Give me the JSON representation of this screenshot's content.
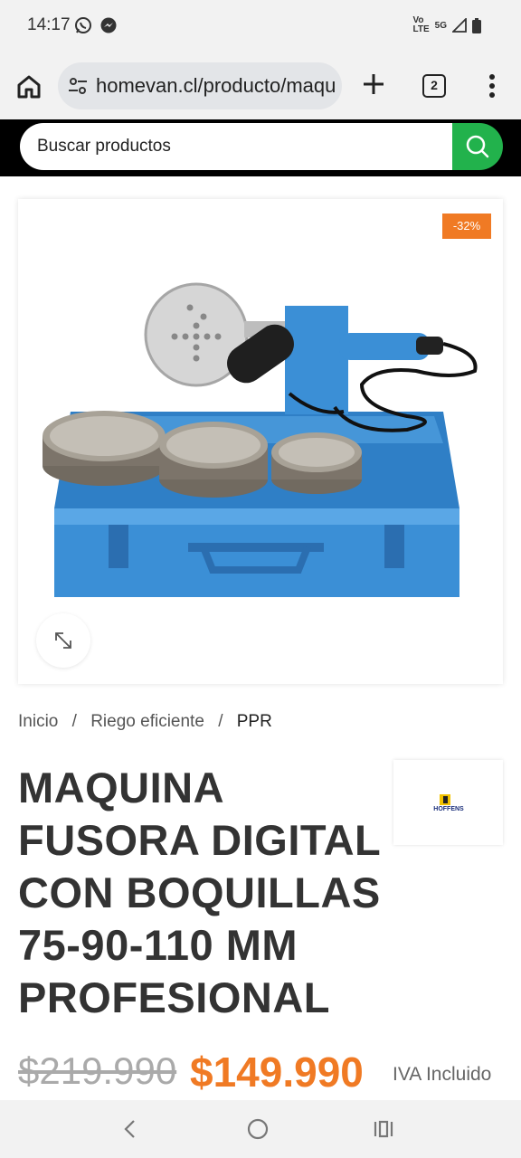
{
  "status": {
    "time": "14:17",
    "net_vo": "Vo",
    "net_lte": "LTE",
    "net_5g": "5G"
  },
  "browser": {
    "url": "homevan.cl/producto/maqu",
    "tab_count": "2"
  },
  "search": {
    "placeholder": "Buscar productos"
  },
  "product": {
    "discount": "-32%",
    "title": "MAQUINA FUSORA DIGITAL CON BOQUILLAS 75-90-110 MM PROFESIONAL",
    "brand": "HOFFENS",
    "old_price": "$219.990",
    "new_price": "$149.990",
    "tax_note": "IVA Incluido"
  },
  "breadcrumb": {
    "items": [
      "Inicio",
      "Riego eficiente",
      "PPR"
    ],
    "separator": "/"
  },
  "colors": {
    "accent": "#f07a24",
    "search_button": "#22b24c",
    "product_blue": "#3b8fd6"
  }
}
